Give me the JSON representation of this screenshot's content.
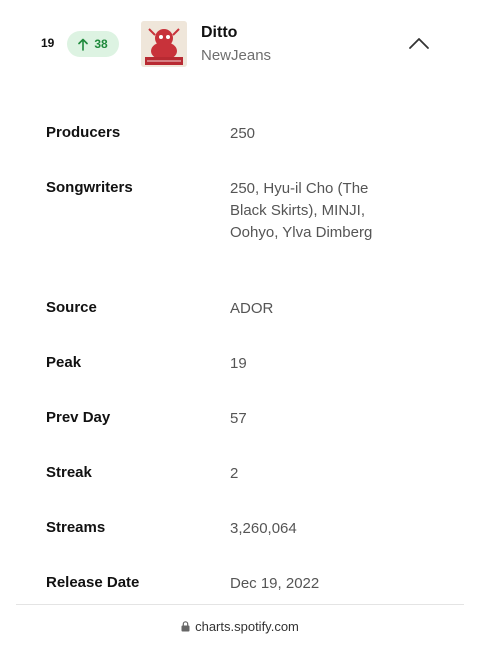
{
  "header": {
    "rank": "19",
    "change": "38",
    "change_direction": "up",
    "change_color": "#1f8a3c",
    "title": "Ditto",
    "artist": "NewJeans",
    "collapse_icon": "chevron-up-icon",
    "cover_accent": "#c8323a"
  },
  "details": [
    {
      "label": "Producers",
      "value": "250"
    },
    {
      "label": "Songwriters",
      "value": "250, Hyu-il Cho (The Black Skirts), MINJI, Oohyo, Ylva Dimberg"
    },
    {
      "label": "Source",
      "value": "ADOR"
    },
    {
      "label": "Peak",
      "value": "19"
    },
    {
      "label": "Prev Day",
      "value": "57"
    },
    {
      "label": "Streak",
      "value": "2"
    },
    {
      "label": "Streams",
      "value": "3,260,064"
    },
    {
      "label": "Release Date",
      "value": "Dec 19, 2022"
    }
  ],
  "browser": {
    "lock_icon": "lock-icon",
    "url": "charts.spotify.com"
  }
}
